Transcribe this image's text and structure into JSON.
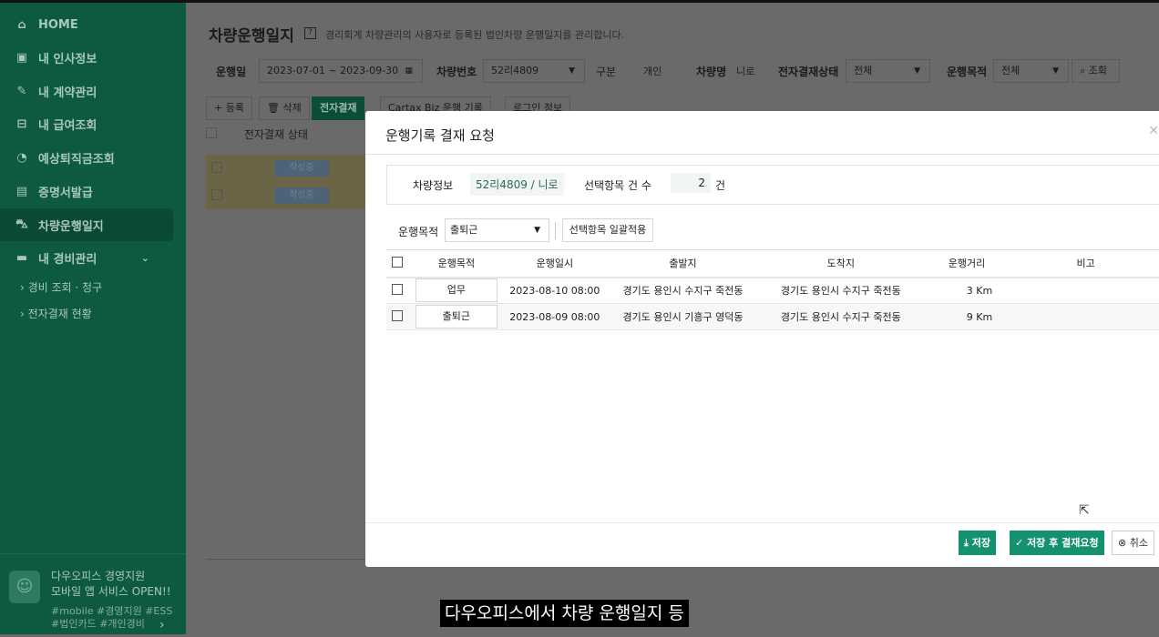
{
  "sidebar": {
    "items": [
      {
        "label": "HOME",
        "icon": "home-icon"
      },
      {
        "label": "내 인사정보",
        "icon": "id-card-icon"
      },
      {
        "label": "내 계약관리",
        "icon": "contract-icon"
      },
      {
        "label": "내 급여조회",
        "icon": "wallet-icon"
      },
      {
        "label": "예상퇴직금조회",
        "icon": "search-money-icon"
      },
      {
        "label": "증명서발급",
        "icon": "certificate-icon"
      },
      {
        "label": "차량운행일지",
        "icon": "car-icon",
        "active": true
      },
      {
        "label": "내 경비관리",
        "icon": "card-icon"
      }
    ],
    "subitems": [
      "경비 조회 · 청구",
      "전자결재 현황"
    ],
    "promo": {
      "line1": "다우오피스 경영지원",
      "line2": "모바일 앱 서비스 OPEN!!",
      "tags1": "#mobile #경영지원 #ESS",
      "tags2": "#법인카드 #개인경비"
    }
  },
  "page": {
    "title": "차량운행일지",
    "description": "경리회계 차량관리의 사용자로 등록된 법인차량 운행일지를 관리합니다.",
    "filters": {
      "date_label": "운행일",
      "date_range": "2023-07-01  ~  2023-09-30",
      "car_no_label": "차량번호",
      "car_no": "52리4809",
      "type_label": "구분",
      "type": "개인",
      "car_name_label": "차량명",
      "car_name": "니로",
      "approval_label": "전자결재상태",
      "approval": "전체",
      "purpose_label": "운행목적",
      "purpose": "전체",
      "search": "조회"
    },
    "toolbar": {
      "add": "+ 등록",
      "delete": "삭제",
      "approval": "전자결재",
      "cartax": "Cartax Biz 운행 기록",
      "login": "로그인 정보"
    },
    "list": {
      "header": "전자결재 상태",
      "rows": [
        {
          "status": "작성중"
        },
        {
          "status": "작성중"
        }
      ]
    }
  },
  "modal": {
    "title": "운행기록 결재 요청",
    "vehicle_label": "차량정보",
    "vehicle": "52리4809 / 니로",
    "count_label": "선택항목 건 수",
    "count": "2",
    "count_unit": "건",
    "purpose_label": "운행목적",
    "purpose_value": "출퇴근",
    "apply_button": "선택항목 일괄적용",
    "columns": [
      "운행목적",
      "운행일시",
      "출발지",
      "도착지",
      "운행거리",
      "비고"
    ],
    "rows": [
      {
        "purpose": "업무",
        "datetime": "2023-08-10 08:00",
        "from": "경기도 용인시 수지구 죽전동",
        "to": "경기도 용인시 수지구 죽전동",
        "distance": "3 Km",
        "note": ""
      },
      {
        "purpose": "출퇴근",
        "datetime": "2023-08-09 08:00",
        "from": "경기도 용인시 기흥구 영덕동",
        "to": "경기도 용인시 수지구 죽전동",
        "distance": "9 Km",
        "note": ""
      }
    ],
    "save": "저장",
    "save_request": "저장 후 결재요청",
    "cancel": "취소"
  },
  "caption": "다우오피스에서 차량 운행일지 등",
  "colors": {
    "brand": "#149270",
    "sidebar": "#0d5a40"
  }
}
